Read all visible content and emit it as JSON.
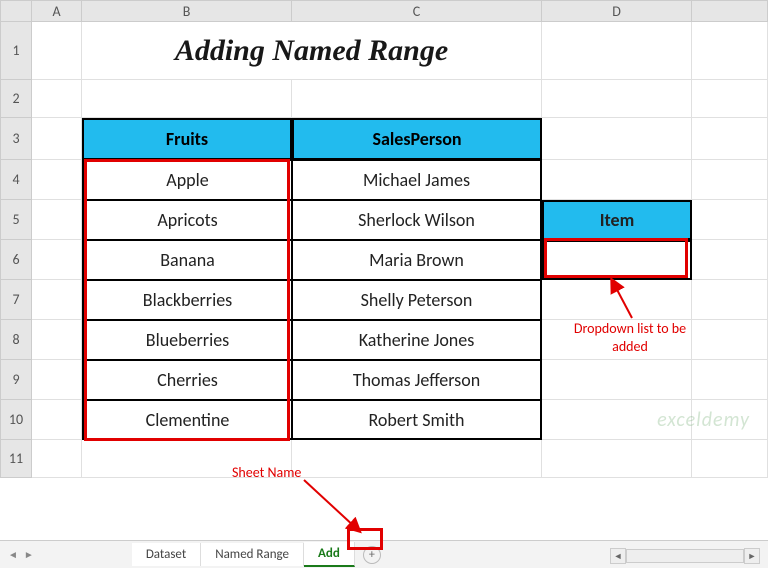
{
  "columns": {
    "A": "A",
    "B": "B",
    "C": "C",
    "D": "D"
  },
  "rows": [
    "1",
    "2",
    "3",
    "4",
    "5",
    "6",
    "7",
    "8",
    "9",
    "10",
    "11"
  ],
  "title": "Adding Named Range",
  "headers": {
    "fruits": "Fruits",
    "sales": "SalesPerson",
    "item": "Item"
  },
  "data": {
    "fruits": [
      "Apple",
      "Apricots",
      "Banana",
      "Blackberries",
      "Blueberries",
      "Cherries",
      "Clementine"
    ],
    "sales": [
      "Michael James",
      "Sherlock Wilson",
      "Maria Brown",
      "Shelly Peterson",
      "Katherine Jones",
      "Thomas Jefferson",
      "Robert Smith"
    ]
  },
  "annotations": {
    "dropdown": "Dropdown list to be added",
    "sheetname": "Sheet Name"
  },
  "tabs": {
    "items": [
      "Dataset",
      "Named Range",
      "Add"
    ],
    "active": "Add",
    "new_label": "+"
  },
  "nav": {
    "first": "◄",
    "prev": "◄",
    "next": "►",
    "last": "►"
  },
  "scroll": {
    "left": "◄",
    "right": "►"
  },
  "watermark": "exceldemy"
}
